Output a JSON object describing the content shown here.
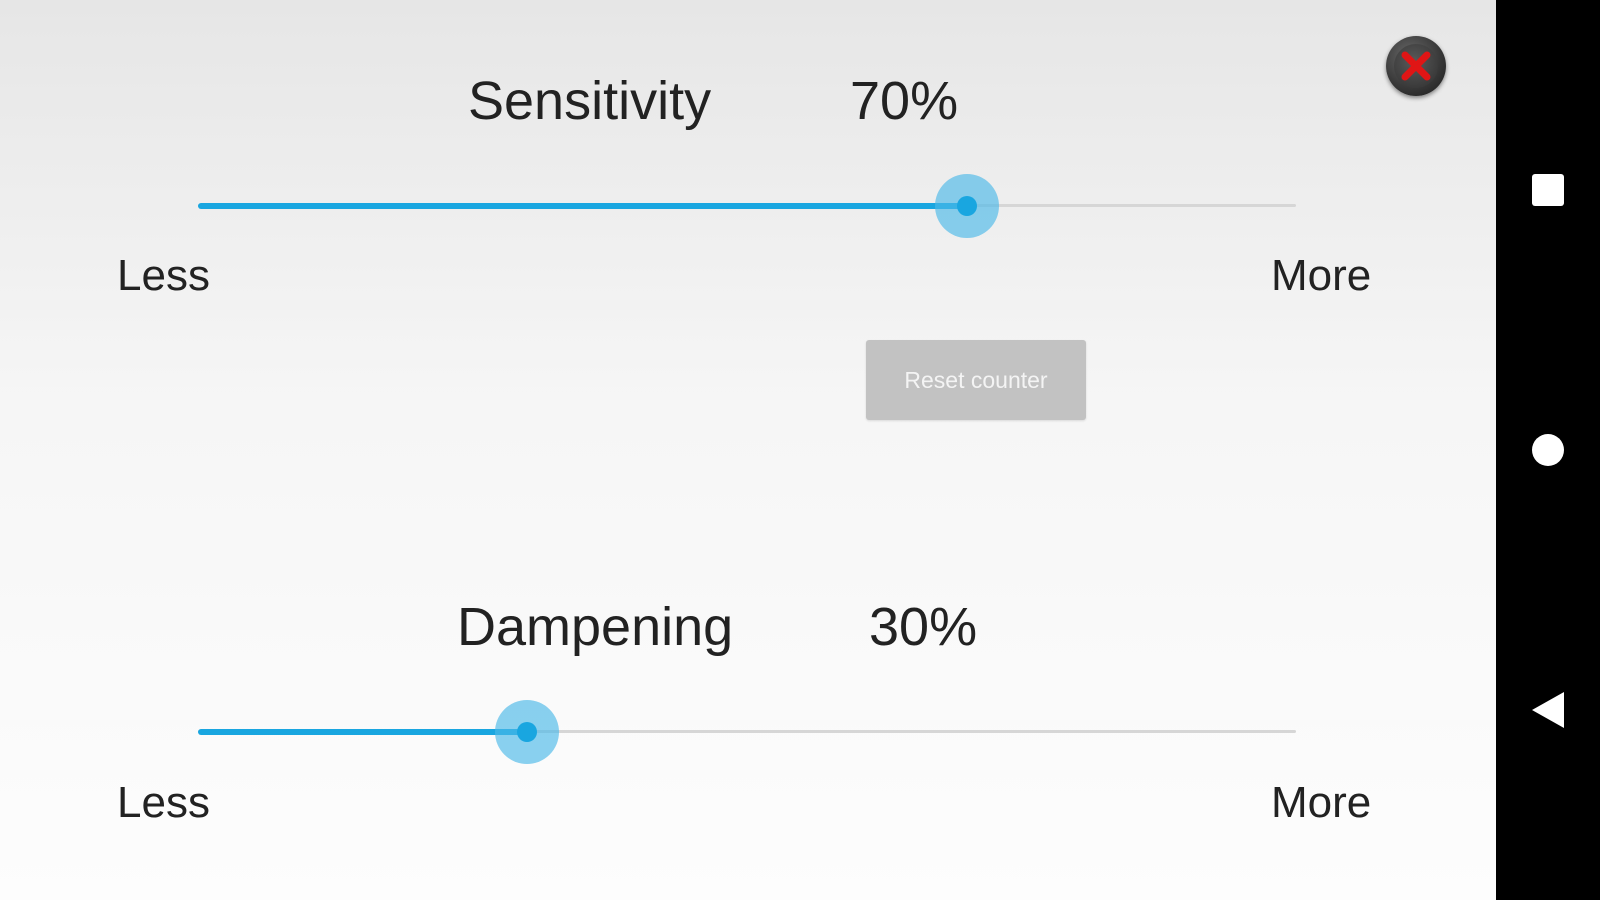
{
  "close_button": {
    "icon": "close-icon",
    "icon_color": "#e01515"
  },
  "sensitivity": {
    "title": "Sensitivity",
    "value_label": "70%",
    "value": 0.7,
    "min_label": "Less",
    "max_label": "More"
  },
  "reset_button": {
    "label": "Reset counter"
  },
  "dampening": {
    "title": "Dampening",
    "value_label": "30%",
    "value": 0.3,
    "min_label": "Less",
    "max_label": "More"
  },
  "nav": {
    "recents_icon": "square-icon",
    "home_icon": "circle-icon",
    "back_icon": "triangle-back-icon"
  },
  "colors": {
    "accent": "#19a6e0",
    "thumb_halo": "#4bb9e8",
    "track": "#d6d6d6",
    "button_bg": "#c2c2c2"
  }
}
